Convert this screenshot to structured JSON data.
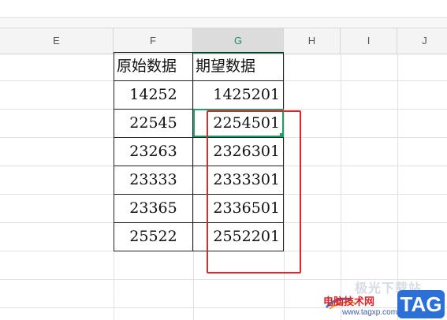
{
  "columns": [
    {
      "letter": "E"
    },
    {
      "letter": "F"
    },
    {
      "letter": "G"
    },
    {
      "letter": "H"
    },
    {
      "letter": "I"
    },
    {
      "letter": "J"
    }
  ],
  "selected_column": "G",
  "table": {
    "headers": [
      "原始数据",
      "期望数据"
    ],
    "rows": [
      [
        "14252",
        "1425201"
      ],
      [
        "22545",
        "2254501"
      ],
      [
        "23263",
        "2326301"
      ],
      [
        "23333",
        "2333301"
      ],
      [
        "23365",
        "2336501"
      ],
      [
        "25522",
        "2552201"
      ]
    ]
  },
  "watermark": {
    "small_text": "极光下载站",
    "site_name": "电脑技术网",
    "url": "www.tagxp.com",
    "logo_text": "TAG"
  },
  "colors": {
    "active_cell": "#1f9e6a",
    "highlight_box": "#e0262b"
  }
}
